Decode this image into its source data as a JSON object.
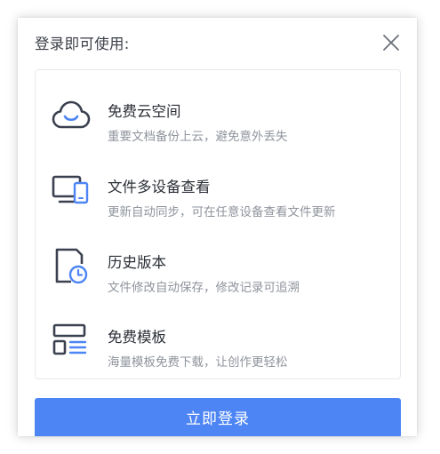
{
  "dialog": {
    "title": "登录即可使用:",
    "close_icon": "close-icon"
  },
  "features": [
    {
      "icon": "cloud-icon",
      "title": "免费云空间",
      "desc": "重要文档备份上云，避免意外丢失"
    },
    {
      "icon": "multi-device-icon",
      "title": "文件多设备查看",
      "desc": "更新自动同步，可在任意设备查看文件更新"
    },
    {
      "icon": "history-icon",
      "title": "历史版本",
      "desc": "文件修改自动保存，修改记录可追溯"
    },
    {
      "icon": "template-icon",
      "title": "免费模板",
      "desc": "海量模板免费下载，让创作更轻松"
    }
  ],
  "login_button": {
    "label": "立即登录"
  },
  "colors": {
    "accent": "#4d85f5",
    "icon_dark": "#3b4050",
    "title_text": "#2b2f36",
    "desc_text": "#8f949c"
  }
}
